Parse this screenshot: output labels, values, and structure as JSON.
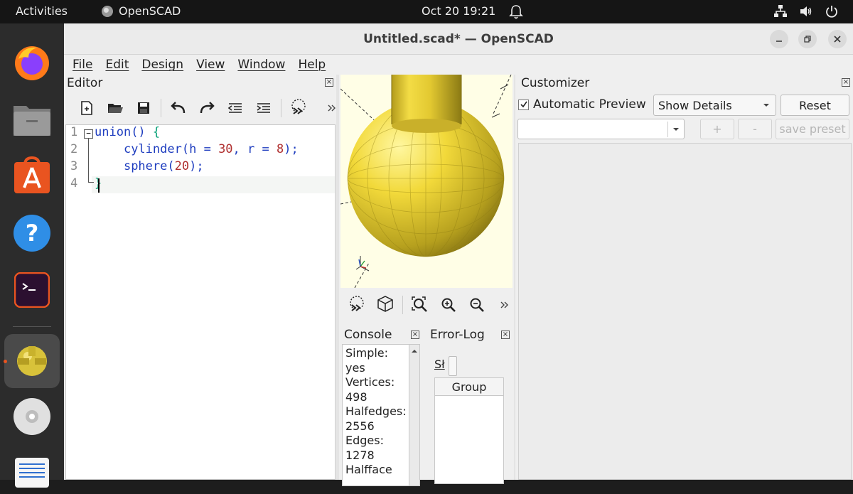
{
  "topbar": {
    "activities": "Activities",
    "app_name": "OpenSCAD",
    "clock": "Oct 20  19:21"
  },
  "window": {
    "title": "Untitled.scad* — OpenSCAD"
  },
  "menu": [
    "File",
    "Edit",
    "Design",
    "View",
    "Window",
    "Help"
  ],
  "editor": {
    "panel_title": "Editor",
    "line_numbers": [
      "1",
      "2",
      "3",
      "4"
    ]
  },
  "console": {
    "panel_title": "Console",
    "text": "  Simple: yes   Vertices: 498   Halfedges:  2556   Edges: 1278   Halfface"
  },
  "error_log": {
    "panel_title": "Error-Log",
    "filter_label": "Sł",
    "group_header": "Group"
  },
  "customizer": {
    "panel_title": "Customizer",
    "auto_preview_label": "Automatic Preview",
    "auto_preview_checked": true,
    "details_select": "Show Details",
    "reset_label": "Reset",
    "preset_select": "",
    "add_preset": "+",
    "remove_preset": "-",
    "save_preset": "save preset"
  },
  "colors": {
    "accent": "#e95420",
    "viewport_bg": "#fffee6",
    "model_yellow": "#f2d93a"
  }
}
